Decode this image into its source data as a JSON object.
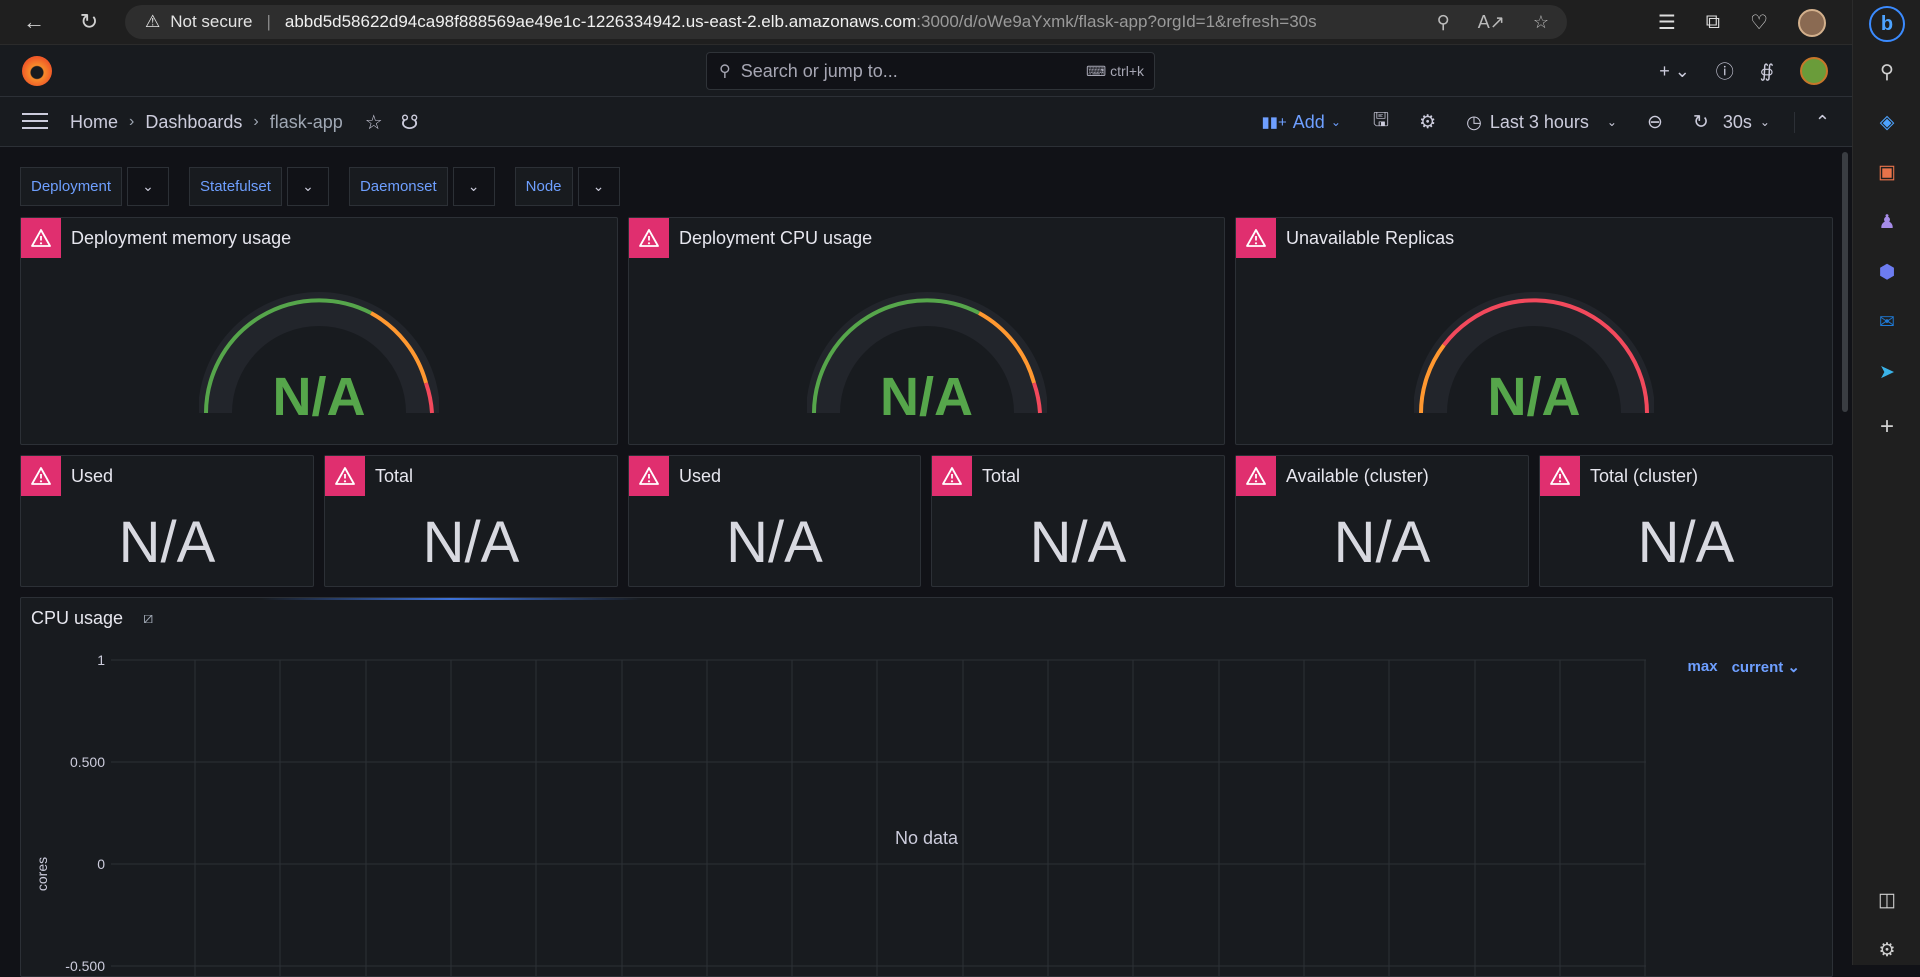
{
  "browser": {
    "not_secure": "Not secure",
    "url_host": "abbd5d58622d94ca98f888569ae49e1c-1226334942.us-east-2.elb.amazonaws.com",
    "url_path": ":3000/d/oWe9aYxmk/flask-app?orgId=1&refresh=30s"
  },
  "grafana": {
    "search_placeholder": "Search or jump to...",
    "search_shortcut": "ctrl+k",
    "breadcrumb": [
      "Home",
      "Dashboards",
      "flask-app"
    ],
    "add_label": "Add",
    "time_range": "Last 3 hours",
    "refresh_interval": "30s"
  },
  "variables": [
    "Deployment",
    "Statefulset",
    "Daemonset",
    "Node"
  ],
  "gauges": [
    {
      "title": "Deployment memory usage",
      "value": "N/A",
      "arc": "green-orange-red"
    },
    {
      "title": "Deployment CPU usage",
      "value": "N/A",
      "arc": "green-orange-red"
    },
    {
      "title": "Unavailable Replicas",
      "value": "N/A",
      "arc": "orange-red"
    }
  ],
  "stats": [
    {
      "title": "Used",
      "value": "N/A"
    },
    {
      "title": "Total",
      "value": "N/A"
    },
    {
      "title": "Used",
      "value": "N/A"
    },
    {
      "title": "Total",
      "value": "N/A"
    },
    {
      "title": "Available (cluster)",
      "value": "N/A"
    },
    {
      "title": "Total (cluster)",
      "value": "N/A"
    }
  ],
  "cpu_panel": {
    "title": "CPU usage",
    "legend": [
      "max",
      "current"
    ],
    "no_data": "No data"
  },
  "chart_data": {
    "type": "line",
    "title": "CPU usage",
    "ylabel": "cores",
    "yticks": [
      "1",
      "0.500",
      "0",
      "-0.500"
    ],
    "series": [],
    "grid": true
  },
  "colors": {
    "accent": "#6e9fff",
    "alert": "#e02f6f",
    "ok": "#56a64b",
    "warn": "#ff9830",
    "crit": "#f2495c"
  }
}
